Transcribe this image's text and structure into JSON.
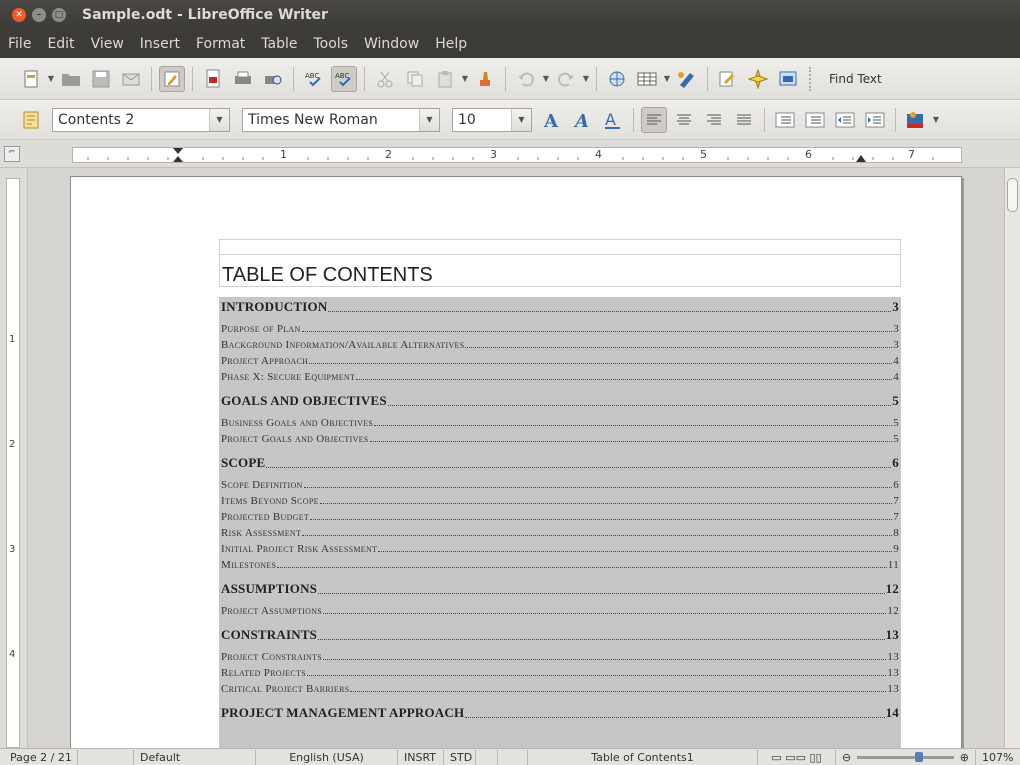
{
  "window": {
    "title": "Sample.odt - LibreOffice Writer"
  },
  "menubar": {
    "items": [
      "File",
      "Edit",
      "View",
      "Insert",
      "Format",
      "Table",
      "Tools",
      "Window",
      "Help"
    ]
  },
  "toolbar_standard": {
    "find_label": "Find Text"
  },
  "toolbar_format": {
    "paragraph_style": "Contents 2",
    "font_name": "Times New Roman",
    "font_size": "10"
  },
  "ruler": {
    "marks": [
      "1",
      "2",
      "3",
      "4",
      "5",
      "6",
      "7"
    ]
  },
  "vruler": {
    "marks": [
      "1",
      "2",
      "3",
      "4"
    ]
  },
  "document": {
    "toc_title": "TABLE OF CONTENTS",
    "entries": [
      {
        "text": "INTRODUCTION",
        "page": "3",
        "level": 1
      },
      {
        "text": "Purpose of Plan",
        "page": "3",
        "level": 2
      },
      {
        "text": "Background Information/Available Alternatives",
        "page": "3",
        "level": 2
      },
      {
        "text": "Project Approach",
        "page": "4",
        "level": 2
      },
      {
        "text": "Phase X: Secure Equipment",
        "page": "4",
        "level": 2
      },
      {
        "text": "GOALS AND OBJECTIVES",
        "page": "5",
        "level": 1
      },
      {
        "text": "Business Goals and Objectives",
        "page": "5",
        "level": 2
      },
      {
        "text": "Project Goals and Objectives",
        "page": "5",
        "level": 2
      },
      {
        "text": "SCOPE",
        "page": "6",
        "level": 1
      },
      {
        "text": "Scope Definition",
        "page": "6",
        "level": 2
      },
      {
        "text": "Items Beyond Scope",
        "page": "7",
        "level": 2
      },
      {
        "text": "Projected Budget",
        "page": "7",
        "level": 2
      },
      {
        "text": "Risk Assessment",
        "page": "8",
        "level": 2
      },
      {
        "text": "Initial Project Risk Assessment",
        "page": "9",
        "level": 2
      },
      {
        "text": "Milestones",
        "page": "11",
        "level": 2
      },
      {
        "text": "ASSUMPTIONS",
        "page": "12",
        "level": 1
      },
      {
        "text": "Project Assumptions",
        "page": "12",
        "level": 2
      },
      {
        "text": "CONSTRAINTS",
        "page": "13",
        "level": 1
      },
      {
        "text": "Project Constraints",
        "page": "13",
        "level": 2
      },
      {
        "text": "Related Projects",
        "page": "13",
        "level": 2
      },
      {
        "text": "Critical Project Barriers",
        "page": "13",
        "level": 2
      },
      {
        "text": "PROJECT MANAGEMENT APPROACH",
        "page": "14",
        "level": 1
      }
    ]
  },
  "statusbar": {
    "page": "Page 2 / 21",
    "page_style": "Default",
    "language": "English (USA)",
    "insert_mode": "INSRT",
    "selection_mode": "STD",
    "section": "Table of Contents1",
    "zoom": "107%"
  }
}
